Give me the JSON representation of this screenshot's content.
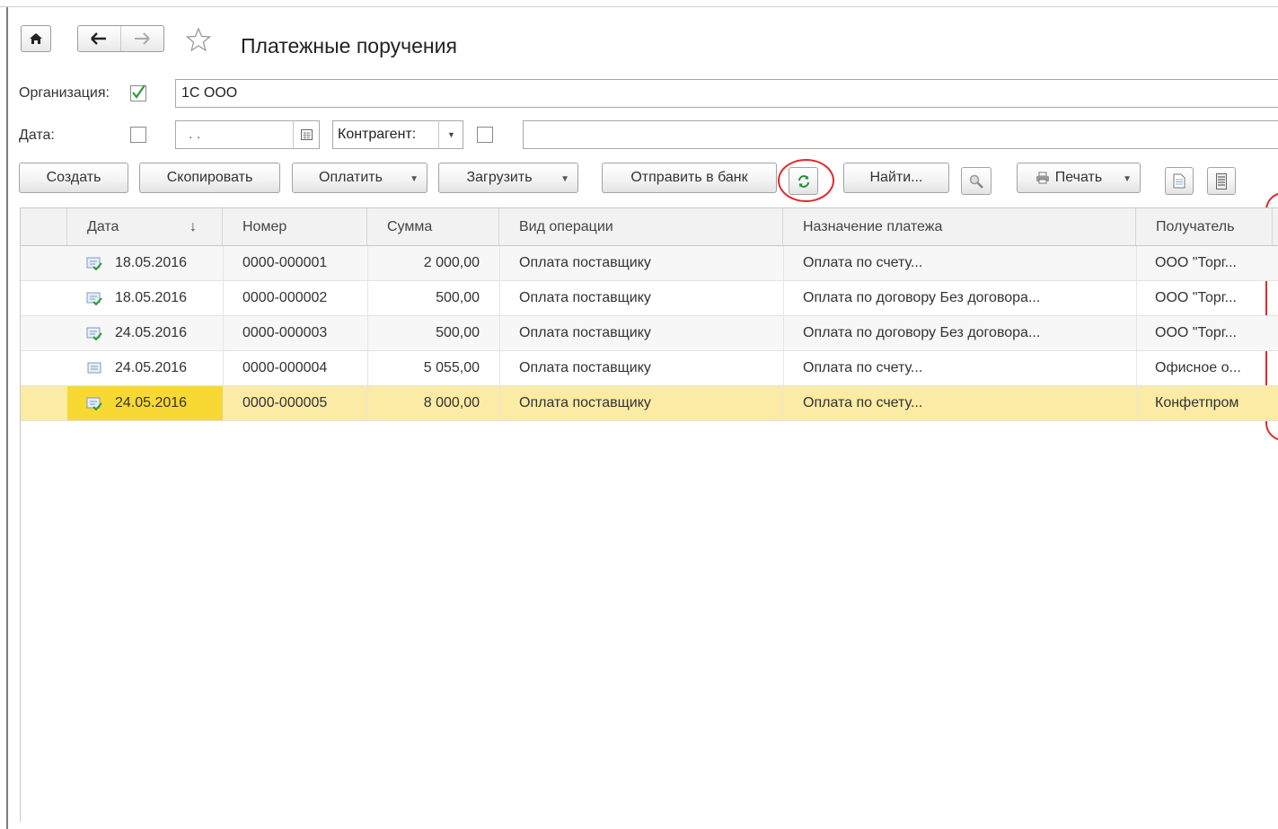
{
  "window": {
    "title": "Платежные поручения"
  },
  "filters": {
    "org_label": "Организация:",
    "org_checked": true,
    "org_value": "1С ООО",
    "date_label": "Дата:",
    "date_checked": false,
    "date_value": ". .",
    "counterparty_select": "Контрагент:",
    "counterparty_checked": false,
    "counterparty_value": ""
  },
  "toolbar": {
    "create": "Создать",
    "copy": "Скопировать",
    "pay": "Оплатить",
    "load": "Загрузить",
    "send_bank": "Отправить в банк",
    "find": "Найти...",
    "print": "Печать"
  },
  "table": {
    "columns": [
      "Дата",
      "Номер",
      "Сумма",
      "Вид операции",
      "Назначение платежа",
      "Получатель"
    ],
    "sort_indicator": "↓",
    "rows": [
      {
        "date": "18.05.2016",
        "number": "0000-000001",
        "sum": "2 000,00",
        "operation": "Оплата поставщику",
        "purpose": "Оплата по счету...",
        "recipient": "ООО \"Торг...",
        "status": "posted"
      },
      {
        "date": "18.05.2016",
        "number": "0000-000002",
        "sum": "500,00",
        "operation": "Оплата поставщику",
        "purpose": "Оплата по договору Без договора...",
        "recipient": "ООО \"Торг...",
        "status": "posted"
      },
      {
        "date": "24.05.2016",
        "number": "0000-000003",
        "sum": "500,00",
        "operation": "Оплата поставщику",
        "purpose": "Оплата по договору Без договора...",
        "recipient": "ООО \"Торг...",
        "status": "posted"
      },
      {
        "date": "24.05.2016",
        "number": "0000-000004",
        "sum": "5 055,00",
        "operation": "Оплата поставщику",
        "purpose": "Оплата по счету...",
        "recipient": "Офисное о...",
        "status": "draft"
      },
      {
        "date": "24.05.2016",
        "number": "0000-000005",
        "sum": "8 000,00",
        "operation": "Оплата поставщику",
        "purpose": "Оплата по счету...",
        "recipient": "Конфетпром",
        "status": "posted",
        "selected": true
      }
    ]
  },
  "colors": {
    "selected_row": "#fbeba4",
    "selected_cell": "#f8d832",
    "highlight": "#e0282b",
    "check": "#2e9a3a"
  }
}
